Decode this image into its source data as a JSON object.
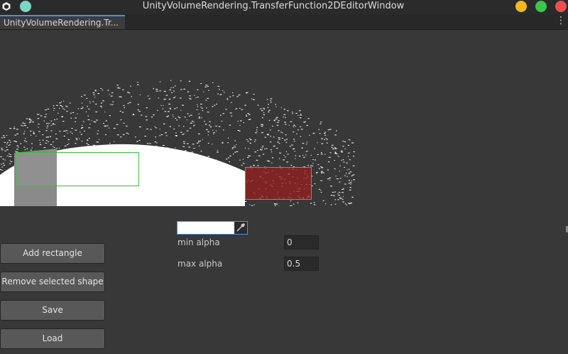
{
  "window": {
    "title": "UnityVolumeRendering.TransferFunction2DEditorWindow",
    "colors": {
      "minimize": "#f3b81e",
      "maximize": "#39c94a",
      "close": "#ef4e4e",
      "pin": "#7ed6c8"
    }
  },
  "tab": {
    "label": "UnityVolumeRendering.Tr..."
  },
  "editor": {
    "shapes": [
      {
        "name": "rectangle-1",
        "color": "#ffffff",
        "selected": true
      },
      {
        "name": "rectangle-2",
        "color": "#ff3030",
        "selected": true
      }
    ],
    "selection_outline_color": "#34c434"
  },
  "properties": {
    "color_value": "#ffffff",
    "min_alpha_label": "min alpha",
    "min_alpha_value": "0",
    "max_alpha_label": "max alpha",
    "max_alpha_value": "0.5"
  },
  "buttons": {
    "add": "Add rectangle",
    "remove": "Remove selected shape",
    "save": "Save",
    "load": "Load"
  }
}
